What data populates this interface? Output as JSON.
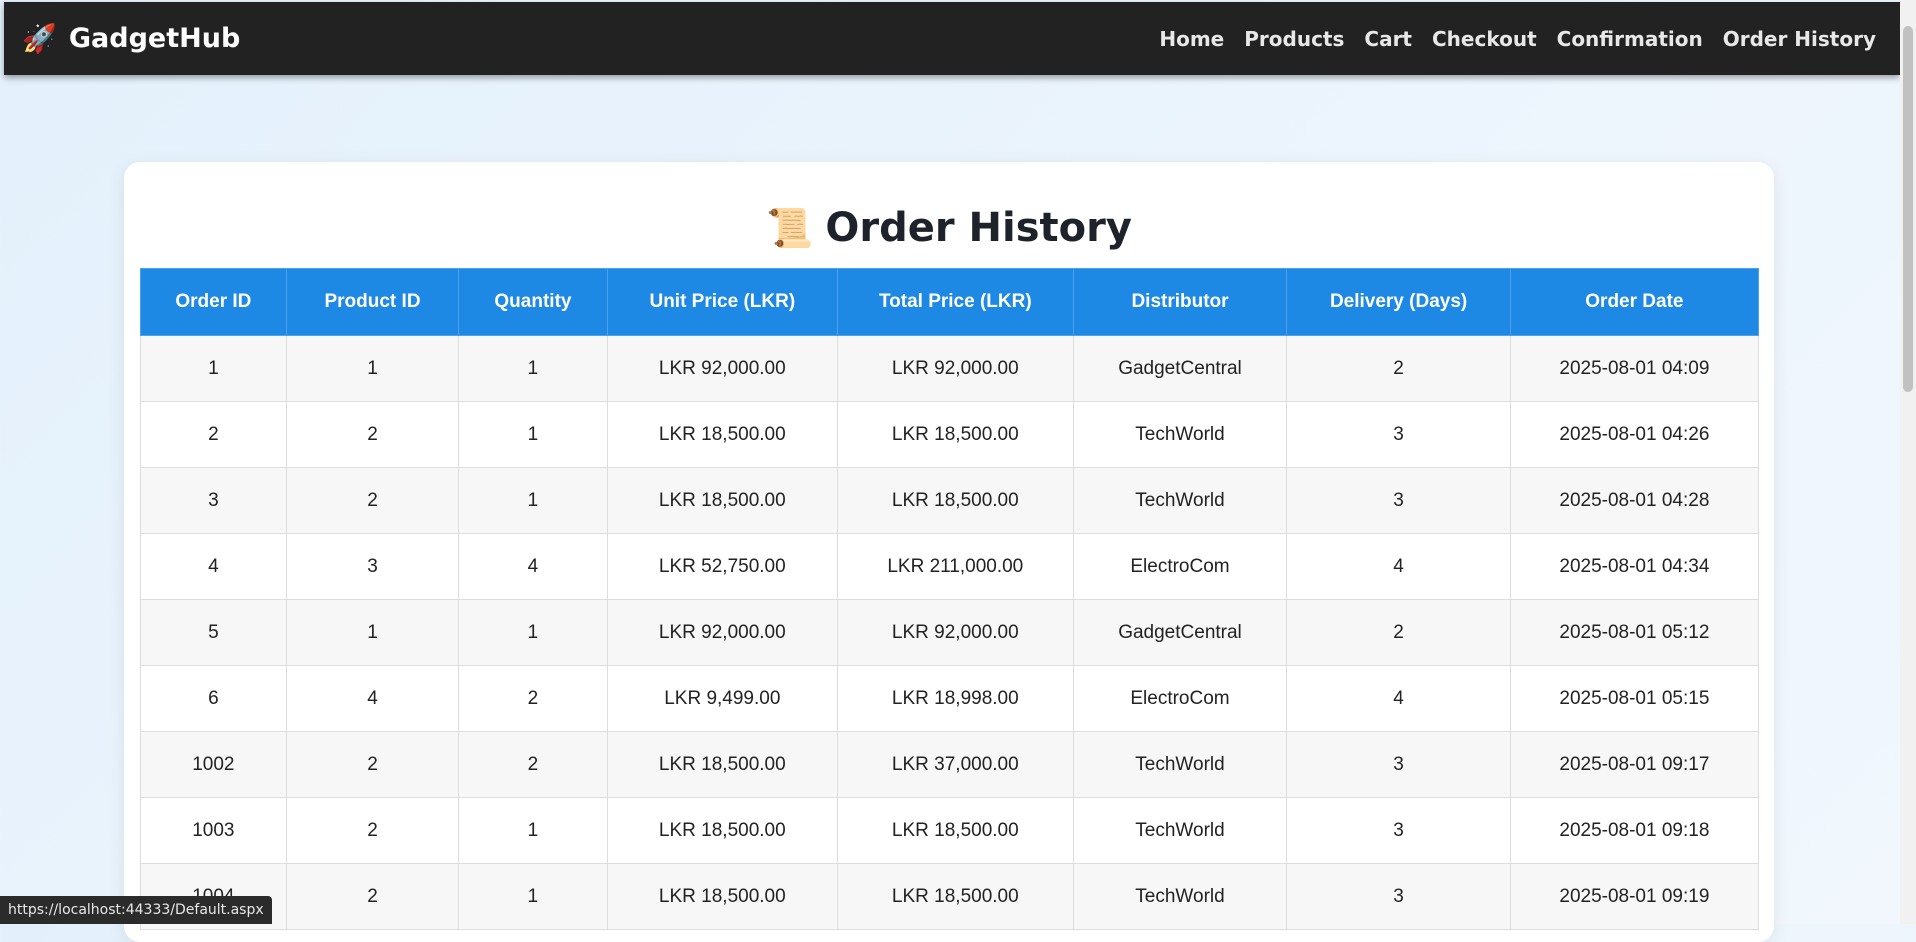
{
  "navbar": {
    "brand_icon": "🚀",
    "brand_name": "GadgetHub",
    "links": [
      "Home",
      "Products",
      "Cart",
      "Checkout",
      "Confirmation",
      "Order History"
    ]
  },
  "page": {
    "icon": "📜",
    "title": "Order History"
  },
  "table": {
    "headers": [
      "Order ID",
      "Product ID",
      "Quantity",
      "Unit Price (LKR)",
      "Total Price (LKR)",
      "Distributor",
      "Delivery (Days)",
      "Order Date"
    ],
    "rows": [
      [
        "1",
        "1",
        "1",
        "LKR 92,000.00",
        "LKR 92,000.00",
        "GadgetCentral",
        "2",
        "2025-08-01 04:09"
      ],
      [
        "2",
        "2",
        "1",
        "LKR 18,500.00",
        "LKR 18,500.00",
        "TechWorld",
        "3",
        "2025-08-01 04:26"
      ],
      [
        "3",
        "2",
        "1",
        "LKR 18,500.00",
        "LKR 18,500.00",
        "TechWorld",
        "3",
        "2025-08-01 04:28"
      ],
      [
        "4",
        "3",
        "4",
        "LKR 52,750.00",
        "LKR 211,000.00",
        "ElectroCom",
        "4",
        "2025-08-01 04:34"
      ],
      [
        "5",
        "1",
        "1",
        "LKR 92,000.00",
        "LKR 92,000.00",
        "GadgetCentral",
        "2",
        "2025-08-01 05:12"
      ],
      [
        "6",
        "4",
        "2",
        "LKR 9,499.00",
        "LKR 18,998.00",
        "ElectroCom",
        "4",
        "2025-08-01 05:15"
      ],
      [
        "1002",
        "2",
        "2",
        "LKR 18,500.00",
        "LKR 37,000.00",
        "TechWorld",
        "3",
        "2025-08-01 09:17"
      ],
      [
        "1003",
        "2",
        "1",
        "LKR 18,500.00",
        "LKR 18,500.00",
        "TechWorld",
        "3",
        "2025-08-01 09:18"
      ],
      [
        "1004",
        "2",
        "1",
        "LKR 18,500.00",
        "LKR 18,500.00",
        "TechWorld",
        "3",
        "2025-08-01 09:19"
      ]
    ]
  },
  "status_bar": {
    "url": "https://localhost:44333/Default.aspx"
  }
}
